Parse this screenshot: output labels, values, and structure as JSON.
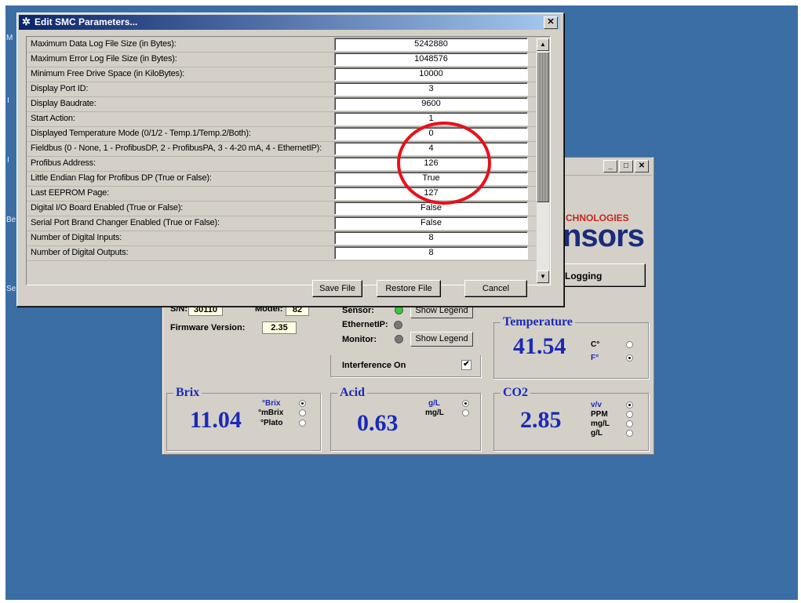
{
  "desktop": {
    "fragments": [
      "M",
      "I",
      "I",
      "Be",
      "Se"
    ]
  },
  "main_window": {
    "title_buttons": [
      "_",
      "□",
      "✕"
    ],
    "logo_top": "CHNOLOGIES",
    "logo_bottom": "nsors",
    "logging_button": "Logging",
    "serial_label": "S/N:",
    "serial_value": "30110",
    "model_label": "Model:",
    "model_value": "82",
    "firmware_label": "Firmware Version:",
    "firmware_value": "2.35",
    "sensor_label": "Sensor:",
    "ethernet_label": "EthernetIP:",
    "monitor_label": "Monitor:",
    "show_legend_1": "Show Legend",
    "show_legend_2": "Show Legend",
    "interference_label": "Interference On",
    "interference_checked": "✔",
    "temperature": {
      "title": "Temperature",
      "value": "41.54",
      "units": [
        "C°",
        "F°"
      ],
      "selected": "F°"
    },
    "brix": {
      "title": "Brix",
      "value": "11.04",
      "units": [
        "°Brix",
        "°mBrix",
        "°Plato"
      ],
      "selected": "°Brix"
    },
    "acid": {
      "title": "Acid",
      "value": "0.63",
      "units": [
        "g/L",
        "mg/L"
      ],
      "selected": "g/L"
    },
    "co2": {
      "title": "CO2",
      "value": "2.85",
      "units": [
        "v/v",
        "PPM",
        "mg/L",
        "g/L"
      ],
      "selected": "v/v"
    },
    "colors": {
      "accent_blue": "#1a2ab8",
      "logo_red": "#c6271e",
      "led_green": "#33cc33",
      "led_gray": "#777777"
    }
  },
  "dialog": {
    "title": "Edit SMC Parameters...",
    "close": "✕",
    "parameters": [
      {
        "label": "Maximum Data Log File Size (in Bytes):",
        "value": "5242880"
      },
      {
        "label": "Maximum Error Log File Size (in Bytes):",
        "value": "1048576"
      },
      {
        "label": "Minimum Free Drive Space (in KiloBytes):",
        "value": "10000"
      },
      {
        "label": "Display Port ID:",
        "value": "3"
      },
      {
        "label": "Display Baudrate:",
        "value": "9600"
      },
      {
        "label": "Start Action:",
        "value": "1"
      },
      {
        "label": "Displayed Temperature Mode (0/1/2 - Temp.1/Temp.2/Both):",
        "value": "0"
      },
      {
        "label": "Fieldbus (0 - None, 1 - ProfibusDP, 2 - ProfibusPA, 3 - 4-20 mA, 4 - EthernetIP):",
        "value": "4"
      },
      {
        "label": "Profibus Address:",
        "value": "126"
      },
      {
        "label": "Little Endian Flag for Profibus DP (True or False):",
        "value": "True"
      },
      {
        "label": "Last EEPROM Page:",
        "value": "127"
      },
      {
        "label": "Digital I/O Board Enabled (True or False):",
        "value": "False"
      },
      {
        "label": "Serial Port Brand Changer Enabled (True or False):",
        "value": "False"
      },
      {
        "label": "Number of Digital Inputs:",
        "value": "8"
      },
      {
        "label": "Number of Digital Outputs:",
        "value": "8"
      }
    ],
    "save_button": "Save File",
    "restore_button": "Restore File",
    "cancel_button": "Cancel",
    "scroll_up": "▲",
    "scroll_down": "▼",
    "highlight_color": "#e8101a"
  }
}
